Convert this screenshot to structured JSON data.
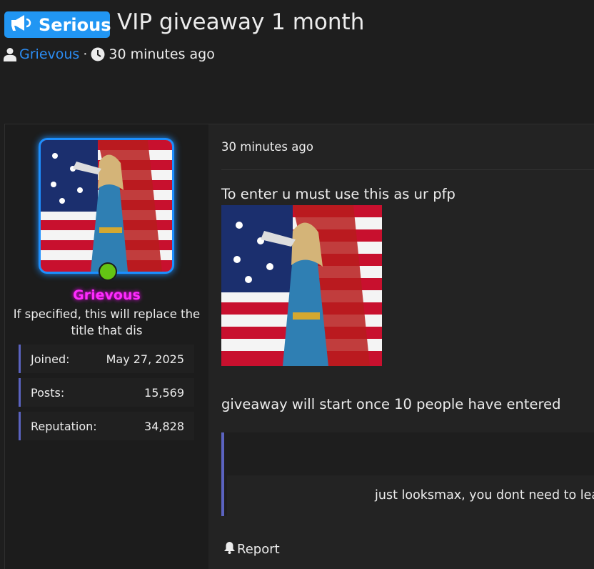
{
  "thread": {
    "prefix_label": "Serious",
    "title": "VIP giveaway 1 month",
    "author": "Grievous",
    "separator": "·",
    "posted_time": "30 minutes ago"
  },
  "sidebar": {
    "username": "Grievous",
    "user_title": "If specified, this will replace the title that dis",
    "stats": [
      {
        "label": "Joined:",
        "value": "May 27, 2025"
      },
      {
        "label": "Posts:",
        "value": "15,569"
      },
      {
        "label": "Reputation:",
        "value": "34,828"
      }
    ],
    "online": true
  },
  "post": {
    "date": "30 minutes ago",
    "line1": "To enter u must use this as ur pfp",
    "line2": "giveaway will start once 10 people have entered",
    "quote_text": "just looksmax, you dont need to lear",
    "report_label": "Report"
  },
  "colors": {
    "prefix_bg": "#2196f3",
    "username_link": "#2b8cf2",
    "username_highlight": "#ff2bff",
    "stat_accent": "#5b63c0",
    "online": "#64c414",
    "avatar_border": "#1c8fff"
  },
  "icons": [
    "megaphone-icon",
    "user-icon",
    "clock-icon",
    "bell-icon"
  ]
}
